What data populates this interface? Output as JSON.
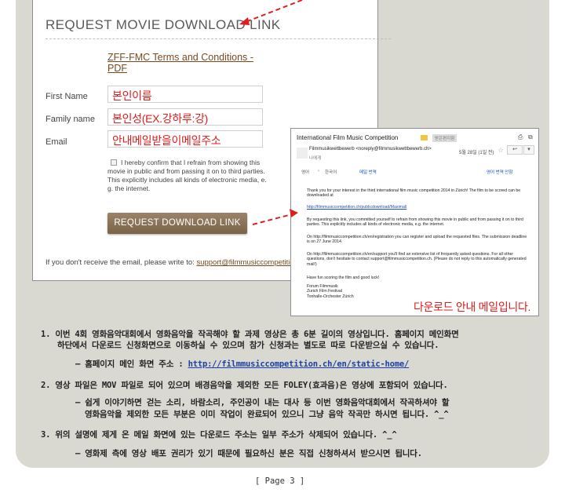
{
  "form": {
    "title": "REQUEST MOVIE DOWNLOAD LINK",
    "terms_link": "ZFF-FMC Terms and Conditions - PDF",
    "first_name_label": "First Name",
    "first_name_value": "본인이름",
    "family_name_label": "Family name",
    "family_name_value": "본인성(EX.강하루:강)",
    "email_label": "Email",
    "email_value": "안내메일받을이메일주소",
    "checkbox_text": "I hereby confirm that I refrain from showing this movie in public and from passing it on to third parties. This explicitly includes all kinds of electronic media, e. g. the internet.",
    "request_button": "REQUEST DOWNLOAD LINK",
    "no_email_text": "If you don't receive the email, please write to: ",
    "support_email": "support@filmmusiccompetition.ch"
  },
  "email": {
    "subject": "International Film Music Competition",
    "label_tag": "받은편지함",
    "sender": "Filmmusikwettbewerb <noreply@filmmusikwettbewerb.ch>",
    "to": "나에게",
    "date": "5월 28일 (1일 전)",
    "reply_icon": "↩",
    "more_icon": "▾",
    "print_icon": "⎙",
    "popout_icon": "⧉",
    "star_icon": "☆",
    "translate_from": "영어",
    "translate_arrow": "›",
    "translate_to": "한국어",
    "translate_action": "메일 번역",
    "translate_off": "영어 번역 안함",
    "paragraphs": [
      "Thank you for your interest in the third international film music competition 2014 in Zürich! The film to be scored can be downloaded at",
      "http://filmmusiccompetition.ch/publicdownload/Maximall",
      "By requesting this link, you committed yourself to refrain from showing this movie in public and from passing it on to third parties. This explicitly includes all kinds of electronic media, e.g. the internet.",
      "On http://filmmusiccompetition.ch/en/registration you can register and upload the requested files. The submission deadline is on 27 June 2014.",
      "On http://filmmusiccompetition.ch/en/support you'll find an extensive list of frequently asked questions. For all other questions, don't hesitate to contact support@filmmusiccompetition.ch. (Please do not reply to this automatically generated mail!)",
      "Have fun scoring the film and good luck!",
      "Forum Filmmusik\nZurich Film Festival\nTonhalle-Orchester Zürich"
    ],
    "note": "다운로드 안내 메일입니다."
  },
  "instructions": {
    "item1_line1": "1. 이번 4회 영화음악대회에서 영화음악을 작곡해야 할 과제 영상은 총 6분 길이의 영상입니다. 홈페이지 메인화면",
    "item1_line2": "하단에서 다운로드 신청화면으로 이동하실 수 있으며 참가 신청과는 별도로 따로 다운받으실 수 있습니다.",
    "item1_sub_prefix": "– 홈페이지 메인 화면 주소 : ",
    "item1_sub_url": "http://filmmusiccompetition.ch/en/static-home/",
    "item2_line1": "2. 영상 파일은 MOV 파일로 되어 있으며 배경음악을 제외한 모든 FOLEY(효과음)은 영상에 포함되어 있습니다.",
    "item2_sub1": "– 쉽게 이야기하면 걷는 소리, 바람소리, 주인공이 내는 대사 등 이번 영화음악대회에서 작곡하셔야 할",
    "item2_sub2": "영화음악을 제외한 모든 부분은 이미 작업이 완료되어 있으니 그냥 음악 작곡만 하시면 됩니다. ^_^",
    "item3_line1": "3. 위의 설명에 제게 온 메일 화면에 있는 다운로드 주소는 일부 주소가 삭제되어 있습니다. ^_^",
    "item3_sub1": "– 영화제 측에 영상 배포 권리가 있기 때문에 필요하신 분은 직접 신청하셔서 받으시면 됩니다."
  },
  "page": {
    "number": "[ Page 3 ]"
  },
  "colors": {
    "panel": "#d9d9d2",
    "annotation_red": "#e01c1c",
    "button_brown": "#8a7257",
    "link_brown": "#7a4a1f",
    "url_blue": "#1a3fa8"
  }
}
